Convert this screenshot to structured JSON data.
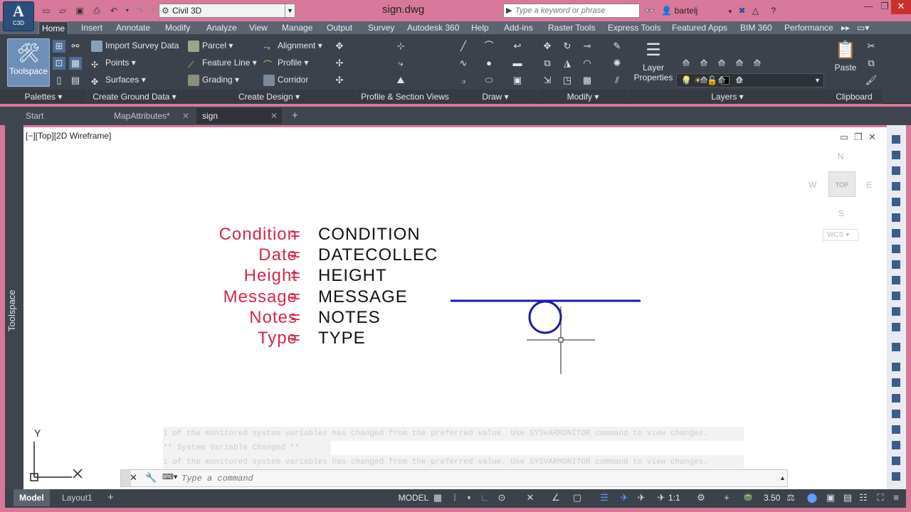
{
  "app": {
    "logo_letter": "A",
    "logo_product": "C3D",
    "workspace": "Civil 3D",
    "doc_title": "sign.dwg",
    "search_placeholder": "Type a keyword or phrase",
    "user": "bartelj"
  },
  "ribbon": {
    "tabs": [
      "Home",
      "Insert",
      "Annotate",
      "Modify",
      "Analyze",
      "View",
      "Manage",
      "Output",
      "Survey",
      "Autodesk 360",
      "Help",
      "Add-ins",
      "Raster Tools",
      "Express Tools",
      "Featured Apps",
      "BIM 360",
      "Performance"
    ],
    "active_tab": "Home",
    "toolspace_label": "Toolspace",
    "buttons": {
      "import_survey": "Import Survey Data",
      "points": "Points",
      "surfaces": "Surfaces",
      "parcel": "Parcel",
      "feature_line": "Feature Line",
      "grading": "Grading",
      "alignment": "Alignment",
      "profile": "Profile",
      "corridor": "Corridor",
      "layer_properties_1": "Layer",
      "layer_properties_2": "Properties",
      "paste": "Paste",
      "current_layer": "0"
    },
    "panels": [
      "Palettes",
      "Create Ground Data",
      "Create Design",
      "Profile & Section Views",
      "Draw",
      "Modify",
      "Layers",
      "Clipboard"
    ]
  },
  "file_tabs": [
    {
      "label": "Start"
    },
    {
      "label": "MapAttributes*"
    },
    {
      "label": "sign"
    }
  ],
  "viewport": {
    "label": "[−][Top][2D Wireframe]",
    "cube": {
      "n": "N",
      "s": "S",
      "e": "E",
      "w": "W",
      "top": "TOP",
      "wcs": "WCS"
    },
    "ucs_y": "Y",
    "attributes": [
      {
        "name": "Condition",
        "eq": "=",
        "value": "CONDITION"
      },
      {
        "name": "Date",
        "eq": "=",
        "value": "DATECOLLEC"
      },
      {
        "name": "Height",
        "eq": "=",
        "value": "HEIGHT"
      },
      {
        "name": "Message",
        "eq": "=",
        "value": "MESSAGE"
      },
      {
        "name": "Notes",
        "eq": "=",
        "value": "NOTES"
      },
      {
        "name": "Type",
        "eq": "=",
        "value": "TYPE"
      }
    ],
    "colors": {
      "attr_name": "#d4284a",
      "attr_value": "#111111",
      "sign_symbol": "#1a1ab0"
    }
  },
  "command": {
    "history": [
      "1 of the monitored system variables has changed from the preferred value. Use SYSVARMONITOR command to view changes.",
      "** System Variable Changed **",
      "1 of the monitored system variables has changed from the preferred value. Use SYSVARMONITOR command to view changes."
    ],
    "placeholder": "Type a command"
  },
  "statusbar": {
    "layout_tabs": [
      "Model",
      "Layout1"
    ],
    "active_layout": "Model",
    "model_label": "MODEL",
    "annotation_scale": "1:1",
    "scale_value": "3.50"
  }
}
